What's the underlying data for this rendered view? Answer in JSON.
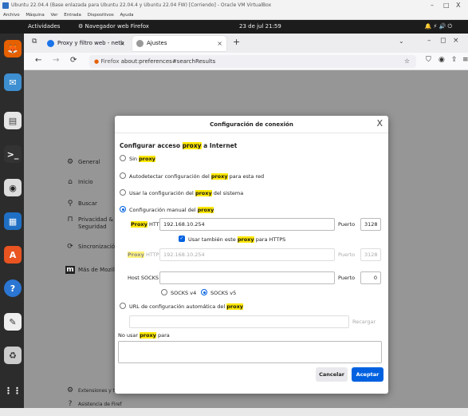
{
  "vbox": {
    "title": "Ubuntu 22.04.4 (Base enlazada para Ubuntu 22.04.4 y Ubuntu 22.04 FW) [Corriendo] - Oracle VM VirtualBox",
    "menu": [
      "Archivo",
      "Máquina",
      "Ver",
      "Entrada",
      "Dispositivos",
      "Ayuda"
    ],
    "controls": [
      "–",
      "□",
      "X"
    ]
  },
  "gnome": {
    "activities": "Actividades",
    "app": "Navegador web Firefox",
    "clock": "23 de jul  21:59",
    "tray": "🔔  ⚡ 🔊 ⏻"
  },
  "tabs": [
    {
      "label": "Proxy y filtro web - netb",
      "icon_color": "#1a73e8"
    },
    {
      "label": "Ajustes",
      "icon_color": "#777777"
    }
  ],
  "urlbar": {
    "prefix": "Firefox",
    "url": "about:preferences#searchResults"
  },
  "sidebar": [
    {
      "icon": "gear-icon",
      "glyph": "⚙",
      "label": "General"
    },
    {
      "icon": "home-icon",
      "glyph": "⌂",
      "label": "Inicio"
    },
    {
      "icon": "search-icon",
      "glyph": "🔍",
      "label": "Buscar"
    },
    {
      "icon": "lock-icon",
      "glyph": "🔒",
      "label": "Privacidad &"
    },
    {
      "icon": "lock-icon",
      "glyph": "",
      "label": "Seguridad"
    },
    {
      "icon": "sync-icon",
      "glyph": "⟳",
      "label": "Sincronización"
    },
    {
      "icon": "mozilla-icon",
      "glyph": "m",
      "label": "Más de Mozilla"
    },
    {
      "icon": "extension-icon",
      "glyph": "⚙",
      "label": "Extensiones y tem"
    },
    {
      "icon": "help-icon",
      "glyph": "?",
      "label": "Asistencia de Firef"
    }
  ],
  "dialog": {
    "title": "Configuración de conexión",
    "close": "X",
    "heading": {
      "pre": "Configurar acceso ",
      "hl": "proxy",
      "post": " a Internet"
    },
    "options": [
      {
        "pre": "Sin ",
        "hl": "proxy",
        "post": ""
      },
      {
        "pre": "Autodetectar configuración del ",
        "hl": "proxy",
        "post": " para esta red"
      },
      {
        "pre": "Usar la configuración del ",
        "hl": "proxy",
        "post": " del sistema"
      },
      {
        "pre": "Configuración manual del ",
        "hl": "proxy",
        "post": ""
      }
    ],
    "http": {
      "hl": "Proxy",
      "post": " HTTP",
      "value": "192.168.10.254",
      "port_label": "Puerto",
      "port": "3128"
    },
    "also_https": {
      "pre": "Usar también este ",
      "hl": "proxy",
      "post": " para HTTPS"
    },
    "https": {
      "hl": "Proxy",
      "post": " HTTPS",
      "value": "192.168.10.254",
      "port_label": "Puerto",
      "port": "3128"
    },
    "socks": {
      "label": "Host SOCKS",
      "value": "",
      "port_label": "Puerto",
      "port": "0"
    },
    "socks_v4": "SOCKS v4",
    "socks_v5": "SOCKS v5",
    "auto_url": {
      "pre": "URL de configuración automática del ",
      "hl": "proxy",
      "post": ""
    },
    "reload": "Recargar",
    "no_proxy": {
      "pre": "No usar ",
      "hl": "proxy",
      "post": " para"
    },
    "cancel": "Cancelar",
    "accept": "Aceptar"
  },
  "colors": {
    "accent": "#0061e0",
    "highlight": "#ffe900"
  }
}
